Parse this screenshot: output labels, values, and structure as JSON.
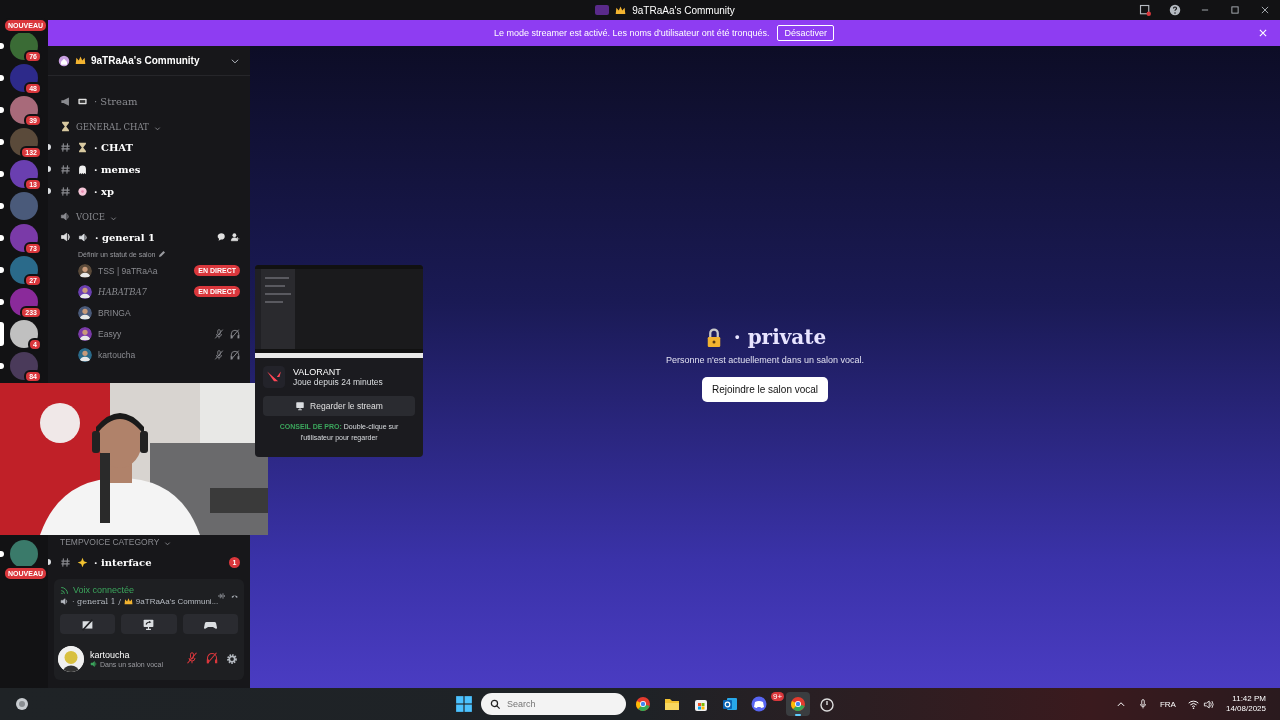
{
  "title_bar": {
    "title": "9aTRaAa's Community"
  },
  "banner": {
    "text": "Le mode streamer est activé. Les noms d'utilisateur ont été tronqués.",
    "button": "Désactiver"
  },
  "servers": [
    {
      "badge": "76",
      "new_label": "NOUVEAU",
      "unread": true,
      "selected": false
    },
    {
      "badge": "48",
      "unread": true,
      "selected": false
    },
    {
      "badge": "39",
      "unread": true,
      "selected": false
    },
    {
      "badge": "132",
      "unread": true,
      "selected": false
    },
    {
      "badge": "13",
      "unread": true,
      "selected": false
    },
    {
      "unread": true,
      "selected": false
    },
    {
      "badge": "73",
      "unread": true,
      "selected": false
    },
    {
      "badge": "27",
      "unread": true,
      "selected": false
    },
    {
      "badge": "233",
      "unread": true,
      "selected": false
    },
    {
      "badge": "4",
      "selected": true
    },
    {
      "badge": "84",
      "unread": true,
      "selected": false
    }
  ],
  "servers_bottom": [
    {
      "new_label": "NOUVEAU",
      "unread": true,
      "selected": false
    }
  ],
  "server_header": {
    "name": "9aTRaAa's Community"
  },
  "channels": [
    {
      "kind": "voice",
      "name": "· Stream",
      "unread": false
    },
    {
      "kind": "category",
      "name": "GENERAL CHAT"
    },
    {
      "kind": "text",
      "name": "· CHAT",
      "unread": true
    },
    {
      "kind": "text",
      "name": "· memes",
      "unread": true
    },
    {
      "kind": "text",
      "name": "· xp",
      "unread": true
    },
    {
      "kind": "category",
      "name": "VOICE"
    },
    {
      "kind": "voice_active",
      "name": "· general 1",
      "status": "Définir un statut de salon"
    }
  ],
  "members": [
    {
      "name": "TSS | 9aTRaAa",
      "badge": "EN DIRECT",
      "muted": false,
      "deafened": false
    },
    {
      "name": "HABATBA7",
      "badge": "EN DIRECT",
      "muted": false,
      "deafened": false
    },
    {
      "name": "BRINGA",
      "muted": false,
      "deafened": false
    },
    {
      "name": "Easyy",
      "muted": true,
      "deafened": true
    },
    {
      "name": "kartoucha",
      "muted": true,
      "deafened": true
    }
  ],
  "lower_channels": [
    {
      "kind": "category",
      "name": "TEMPVOICE CATEGORY"
    },
    {
      "kind": "text",
      "name": "· interface",
      "unread": true,
      "mentions": "1"
    }
  ],
  "voice_panel": {
    "status": "Voix connectée",
    "channel": "· general 1 /",
    "server": "9aTRaAa's Communi..."
  },
  "user_panel": {
    "name": "kartoucha",
    "status": "Dans un salon vocal",
    "muted": true,
    "deafened": true
  },
  "stream_popup": {
    "game": "VALORANT",
    "activity": "Joue depuis 24 minutes",
    "button": "Regarder le stream",
    "tip": "**CONSEIL DE PRO:** Double-clique sur l'utilisateur pour regarder"
  },
  "main": {
    "channel": "· private",
    "message": "Personne n'est actuellement dans un salon vocal.",
    "button": "Rejoindre le salon vocal"
  },
  "taskbar": {
    "search_placeholder": "Search",
    "apps": [
      {
        "kind": "browser",
        "active": false
      },
      {
        "kind": "folder",
        "active": false
      },
      {
        "kind": "store",
        "active": false
      },
      {
        "kind": "mail",
        "active": false
      },
      {
        "kind": "chat",
        "active": false,
        "badge": "9+"
      },
      {
        "kind": "browser",
        "active": true
      },
      {
        "kind": "timer",
        "active": false
      }
    ],
    "language": "FRA",
    "time": "11:42 PM",
    "date": "14/08/2025"
  }
}
